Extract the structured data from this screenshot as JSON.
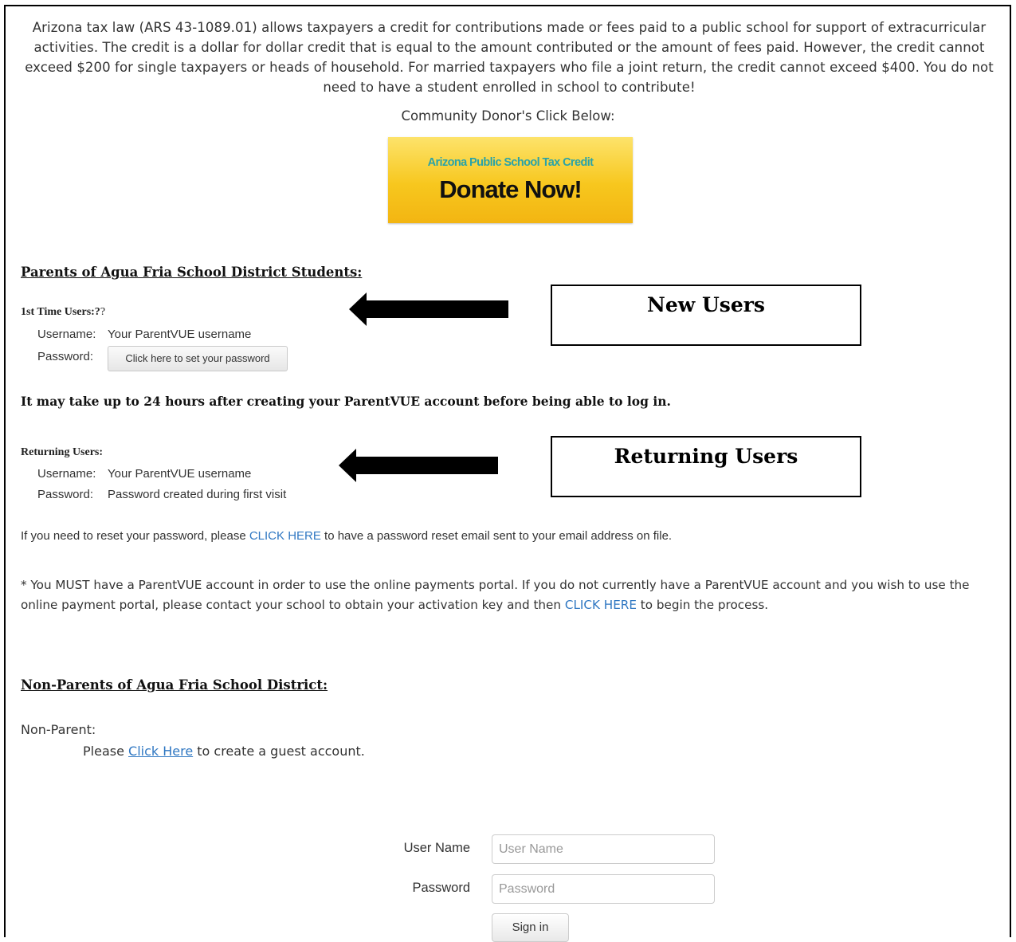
{
  "intro": {
    "text": "Arizona tax law (ARS 43-1089.01) allows taxpayers a credit for contributions made or fees paid to a public school for support of extracurricular activities. The credit is a dollar for dollar credit that is equal to the amount contributed or the amount of fees paid. However, the credit cannot exceed $200 for single taxpayers or heads of household. For married taxpayers who file a joint return, the credit cannot exceed $400. You do not need to have a student enrolled in school to contribute!",
    "donor_label": "Community Donor's Click Below:"
  },
  "donate_button": {
    "small_text": "Arizona Public School Tax Credit",
    "big_text": "Donate Now!",
    "colors": {
      "gradient_top": "#fde36b",
      "gradient_bottom": "#f3b512",
      "small_text": "#2aa3a8"
    }
  },
  "parents": {
    "heading": "Parents of Agua Fria School District Students:",
    "first_time": {
      "label": "1st Time Users:?",
      "suffix": "?",
      "username_key": "Username:",
      "username_value": "Your ParentVUE username",
      "password_key": "Password:",
      "password_button": "Click here to set your password"
    },
    "warning": "It may take up to 24 hours after creating your ParentVUE account before being able to log in.",
    "returning": {
      "label": "Returning Users:",
      "username_key": "Username:",
      "username_value": "Your ParentVUE username",
      "password_key": "Password:",
      "password_value": "Password created during first visit"
    },
    "reset": {
      "before": "If you need to reset your password, please ",
      "link": "CLICK HERE",
      "after": " to have a password reset email sent to your email address on file."
    },
    "note": {
      "before": " * You MUST have a ParentVUE account in order to use the online payments portal.  If you do not currently have a ParentVUE account and you wish to use the online payment portal, please contact your school to obtain your activation key and then ",
      "link": "CLICK HERE",
      "after": " to begin the process."
    }
  },
  "callouts": {
    "new_users": "New Users",
    "returning_users": "Returning Users"
  },
  "non_parents": {
    "heading": "Non-Parents of Agua Fria School District:",
    "label": "Non-Parent:",
    "before": "Please ",
    "link": "Click Here",
    "after": " to create a guest account."
  },
  "login": {
    "username_label": "User Name",
    "username_placeholder": "User Name",
    "password_label": "Password",
    "password_placeholder": "Password",
    "signin_label": "Sign in"
  },
  "colors": {
    "link": "#2f77c2",
    "text": "#333333"
  }
}
